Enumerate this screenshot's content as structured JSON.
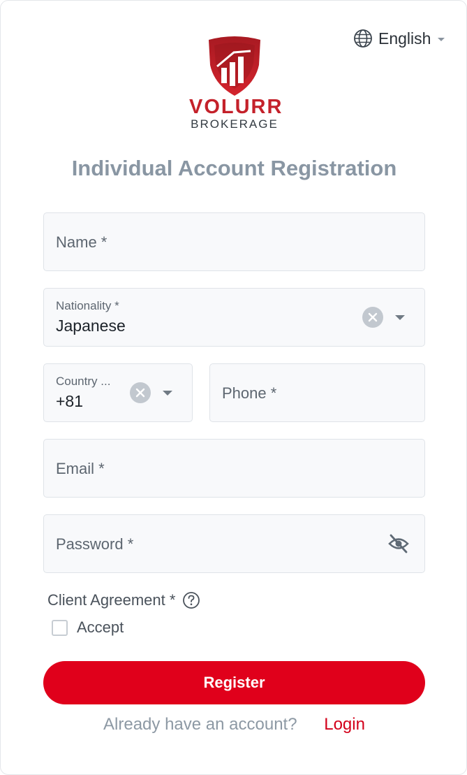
{
  "language": {
    "label": "English",
    "icon": "globe-icon"
  },
  "brand": {
    "name": "VOLURR",
    "subtitle": "BROKERAGE",
    "primary_color": "#c4212a"
  },
  "title": "Individual Account Registration",
  "form": {
    "name": {
      "placeholder": "Name *"
    },
    "nationality": {
      "label": "Nationality *",
      "value": "Japanese"
    },
    "country_code": {
      "label": "Country ...",
      "value": "+81"
    },
    "phone": {
      "placeholder": "Phone *"
    },
    "email": {
      "placeholder": "Email *"
    },
    "password": {
      "placeholder": "Password *",
      "icon": "eye-slash-icon"
    },
    "agreement": {
      "label": "Client Agreement *",
      "icon": "help-icon",
      "accept_label": "Accept",
      "accepted": false
    }
  },
  "register_button": {
    "label": "Register",
    "color": "#e0001b"
  },
  "footer": {
    "question": "Already have an account?",
    "login_label": "Login"
  }
}
